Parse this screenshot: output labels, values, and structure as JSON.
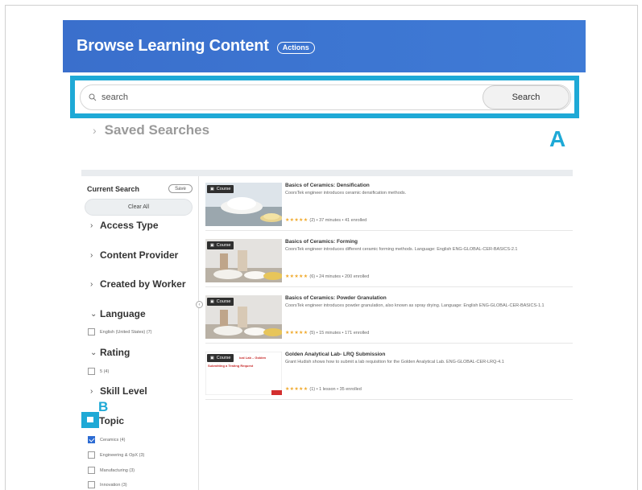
{
  "header": {
    "title": "Browse Learning Content",
    "actions_label": "Actions"
  },
  "search": {
    "placeholder": "search",
    "value": "",
    "button_label": "Search"
  },
  "saved_searches": {
    "label": "Saved Searches"
  },
  "annotations": {
    "a": "A",
    "b": "B",
    "accent": "#1ea9d6"
  },
  "sidebar": {
    "current_search_label": "Current Search",
    "save_label": "Save",
    "clear_all_label": "Clear All",
    "facets": {
      "access_type": "Access Type",
      "content_provider": "Content Provider",
      "created_by_worker": "Created by Worker",
      "language": "Language",
      "rating": "Rating",
      "skill_level": "Skill Level",
      "topic": "Topic"
    },
    "language_options": [
      {
        "label": "English (United States) (7)",
        "checked": false
      }
    ],
    "rating_options": [
      {
        "label": "5 (4)",
        "checked": false
      }
    ],
    "topic_options": [
      {
        "label": "Ceramics (4)",
        "checked": true
      },
      {
        "label": "Engineering & OpX (3)",
        "checked": false
      },
      {
        "label": "Manufacturing (3)",
        "checked": false
      },
      {
        "label": "Innovation (3)",
        "checked": false
      }
    ]
  },
  "results": [
    {
      "badge": "Course",
      "title": "Basics of Ceramics: Densification",
      "description": "CoorsTek engineer introduces ceramic densification methods.",
      "stars": "★★★★★",
      "meta": "(2)  •  37 minutes  •  41 enrolled"
    },
    {
      "badge": "Course",
      "title": "Basics of Ceramics: Forming",
      "description": "CoorsTek engineer introduces different ceramic forming methods. Language: English ENG-GLOBAL-CER-BASICS-2.1",
      "stars": "★★★★★",
      "meta": "(6)  •  24 minutes  •  200 enrolled"
    },
    {
      "badge": "Course",
      "title": "Basics of Ceramics: Powder Granulation",
      "description": "CoorsTek engineer introduces powder granulation, also known as spray drying. Language: English ENG-GLOBAL-CER-BASICS-1.1",
      "stars": "★★★★★",
      "meta": "(5)  •  15 minutes  •  171 enrolled"
    },
    {
      "badge": "Course",
      "title": "Golden Analytical Lab- LRQ Submission",
      "description": "Grant Hudish shows how to submit a lab requisition for the Golden Analytical Lab. ENG-GLOBAL-CER-LRQ-4.1",
      "stars": "★★★★★",
      "meta": "(1)  •  1 lesson  •  35 enrolled",
      "thumb_text_1": "ical Lab – Golden",
      "thumb_text_2": "Submitting a Testing Request"
    }
  ]
}
